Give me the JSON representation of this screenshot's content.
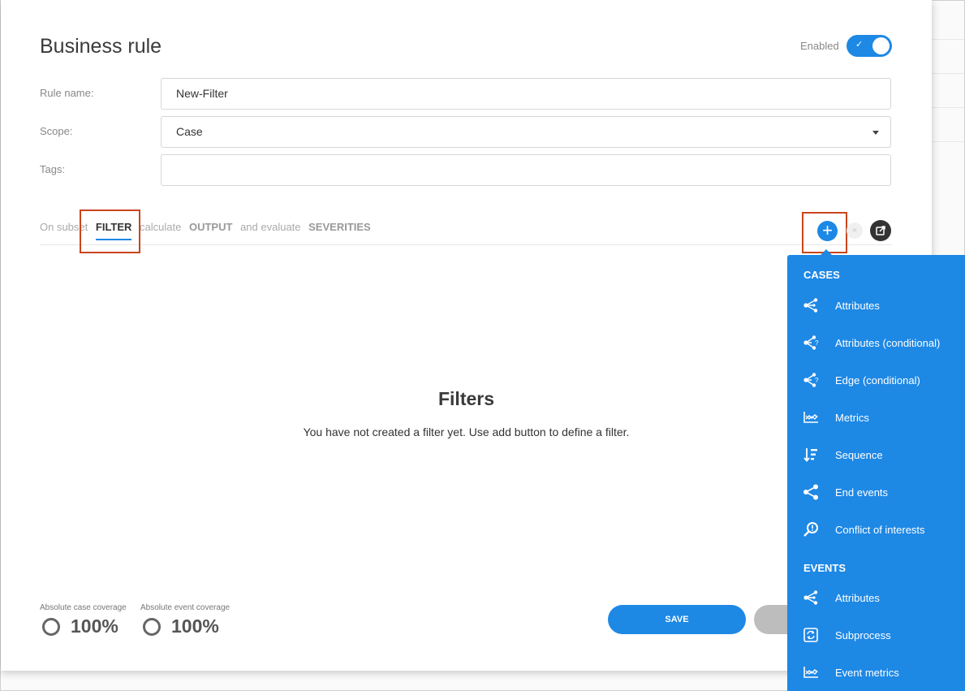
{
  "dialog": {
    "title": "Business rule",
    "enabled_label": "Enabled",
    "enabled": true
  },
  "form": {
    "rule_name_label": "Rule name:",
    "rule_name_value": "New-Filter",
    "scope_label": "Scope:",
    "scope_value": "Case",
    "tags_label": "Tags:",
    "tags_value": ""
  },
  "tabs": {
    "on_subset": "On subset",
    "filter": "FILTER",
    "calculate": "calculate",
    "output": "OUTPUT",
    "and_evaluate": "and evaluate",
    "severities": "SEVERITIES"
  },
  "empty_state": {
    "title": "Filters",
    "description": "You have not created a filter yet. Use add button to define a filter."
  },
  "coverage": {
    "case_label": "Absolute case coverage",
    "case_value": "100%",
    "event_label": "Absolute event coverage",
    "event_value": "100%"
  },
  "buttons": {
    "save": "SAVE",
    "add": "+"
  },
  "menu": {
    "cases_header": "CASES",
    "cases_items": [
      {
        "label": "Attributes",
        "icon": "share-icon"
      },
      {
        "label": "Attributes (conditional)",
        "icon": "share-question-icon"
      },
      {
        "label": "Edge (conditional)",
        "icon": "share-question-icon"
      },
      {
        "label": "Metrics",
        "icon": "chart-icon"
      },
      {
        "label": "Sequence",
        "icon": "sort-icon"
      },
      {
        "label": "End events",
        "icon": "share-icon"
      },
      {
        "label": "Conflict of interests",
        "icon": "search-alert-icon"
      }
    ],
    "events_header": "EVENTS",
    "events_items": [
      {
        "label": "Attributes",
        "icon": "share-icon"
      },
      {
        "label": "Subprocess",
        "icon": "subprocess-icon"
      },
      {
        "label": "Event metrics",
        "icon": "chart-icon"
      }
    ]
  },
  "colors": {
    "accent": "#1e88e5",
    "highlight": "#c9451c"
  }
}
